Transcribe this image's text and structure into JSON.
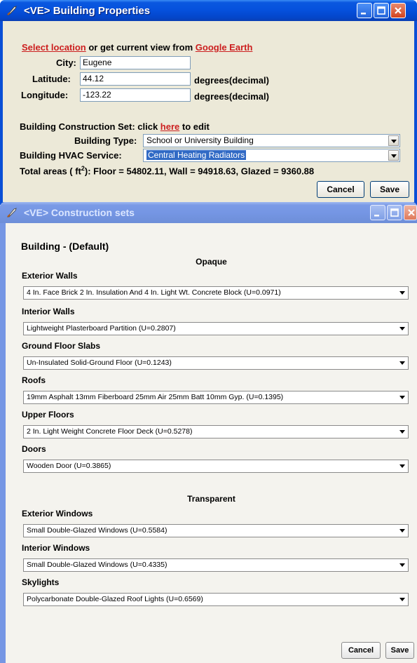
{
  "properties_window": {
    "title": "<VE> Building Properties",
    "location_line": {
      "select_link": "Select location",
      "middle_text": " or get current view from ",
      "google_link": "Google Earth"
    },
    "city": {
      "label": "City:",
      "value": "Eugene"
    },
    "latitude": {
      "label": "Latitude:",
      "value": "44.12",
      "unit": "degrees(decimal)"
    },
    "longitude": {
      "label": "Longitude:",
      "value": "-123.22",
      "unit": "degrees(decimal)"
    },
    "construction_set": {
      "prefix": "Building Construction Set: click ",
      "link": "here",
      "suffix": " to edit"
    },
    "building_type": {
      "label": "Building Type:",
      "value": "School or University Building"
    },
    "hvac": {
      "label": "Building HVAC Service:",
      "value": "Central Heating Radiators"
    },
    "total_areas": {
      "prefix": "Total areas ( ft",
      "sup": "2",
      "suffix": "): Floor = 54802.11, Wall = 94918.63, Glazed = 9360.88"
    },
    "buttons": {
      "cancel": "Cancel",
      "save": "Save"
    }
  },
  "construction_window": {
    "title": "<VE> Construction sets",
    "heading": "Building - (Default)",
    "opaque_label": "Opaque",
    "transparent_label": "Transparent",
    "opaque_fields": [
      {
        "label": "Exterior Walls",
        "value": "4 In. Face Brick 2 In. Insulation And 4 In. Light Wt. Concrete Block (U=0.0971)"
      },
      {
        "label": "Interior Walls",
        "value": "Lightweight Plasterboard Partition (U=0.2807)"
      },
      {
        "label": "Ground Floor Slabs",
        "value": "Un-Insulated Solid-Ground Floor (U=0.1243)"
      },
      {
        "label": "Roofs",
        "value": "19mm Asphalt 13mm Fiberboard 25mm Air 25mm Batt 10mm Gyp. (U=0.1395)"
      },
      {
        "label": "Upper Floors",
        "value": "2 In. Light Weight Concrete Floor Deck (U=0.5278)"
      },
      {
        "label": "Doors",
        "value": "Wooden Door (U=0.3865)"
      }
    ],
    "transparent_fields": [
      {
        "label": "Exterior Windows",
        "value": "Small Double-Glazed Windows (U=0.5584)"
      },
      {
        "label": "Interior Windows",
        "value": "Small Double-Glazed Windows (U=0.4335)"
      },
      {
        "label": "Skylights",
        "value": "Polycarbonate Double-Glazed Roof Lights (U=0.6569)"
      }
    ],
    "buttons": {
      "cancel": "Cancel",
      "save": "Save"
    }
  },
  "colors": {
    "title_active": "#0550dc",
    "title_inactive": "#7596e4",
    "link": "#cc1f1f",
    "selection": "#316ac5"
  },
  "icons": [
    "app-feather-icon",
    "minimize-icon",
    "maximize-icon",
    "close-icon",
    "dropdown-arrow-icon"
  ]
}
